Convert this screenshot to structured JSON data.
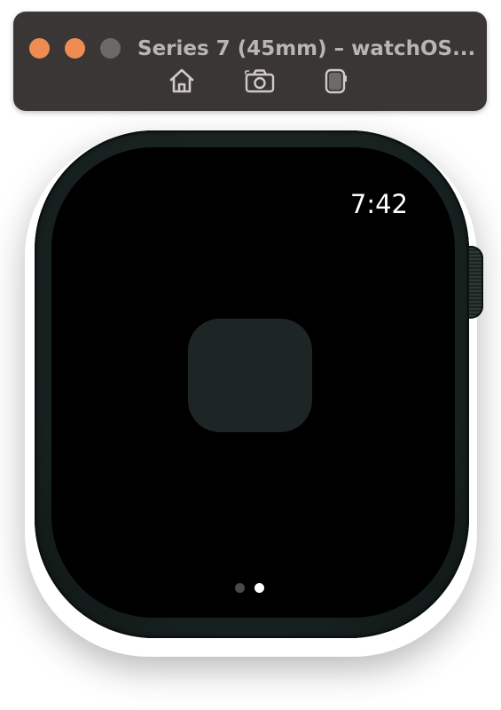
{
  "window": {
    "title": "Series 7 (45mm) – watchOS...",
    "traffic_light_colors": {
      "close": "#ee8c52",
      "minimize": "#ee8c52",
      "zoom": "#6b6867"
    }
  },
  "toolbar": {
    "buttons": [
      {
        "icon": "home-icon"
      },
      {
        "icon": "camera-icon"
      },
      {
        "icon": "rotate-device-icon"
      }
    ]
  },
  "watch": {
    "case_color": "#16201e",
    "screen_color": "#000000",
    "time": "7:42",
    "app_tile_color": "#1e2625",
    "page_indicator": {
      "total": 2,
      "current": 2
    }
  }
}
